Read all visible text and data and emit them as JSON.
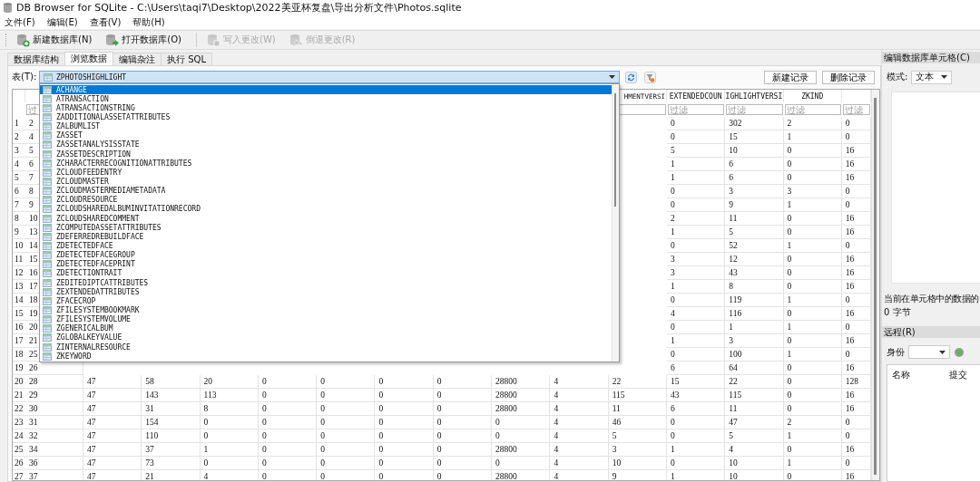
{
  "window": {
    "title": "DB Browser for SQLite - C:\\Users\\taqi7\\Desktop\\2022美亚杯复盘\\导出分析文件\\Photos.sqlite"
  },
  "menu": [
    "文件(F)",
    "编辑(E)",
    "查看(V)",
    "帮助(H)"
  ],
  "toolbar": [
    {
      "kind": "new",
      "label": "新建数据库(N)",
      "disabled": false
    },
    {
      "kind": "open",
      "label": "打开数据库(O)",
      "disabled": false
    },
    {
      "kind": "write",
      "label": "写入更改(W)",
      "disabled": true
    },
    {
      "kind": "revert",
      "label": "倒退更改(R)",
      "disabled": true
    }
  ],
  "tabs": [
    {
      "label": "数据库结构",
      "selected": false
    },
    {
      "label": "浏览数据",
      "selected": true
    },
    {
      "label": "编辑杂注",
      "selected": false
    },
    {
      "label": "执行 SQL",
      "selected": false
    }
  ],
  "table_picker": {
    "label": "表(T):",
    "value": "ZPHOTOSHIGHLIGHT",
    "expanded": true,
    "options": [
      {
        "label": "ACHANGE",
        "selected": true
      },
      {
        "label": "ATRANSACTION",
        "selected": false
      },
      {
        "label": "ATRANSACTIONSTRING",
        "selected": false
      },
      {
        "label": "ZADDITIONALASSETATTRIBUTES",
        "selected": false
      },
      {
        "label": "ZALBUMLIST",
        "selected": false
      },
      {
        "label": "ZASSET",
        "selected": false
      },
      {
        "label": "ZASSETANALYSISSTATE",
        "selected": false
      },
      {
        "label": "ZASSETDESCRIPTION",
        "selected": false
      },
      {
        "label": "ZCHARACTERRECOGNITIONATTRIBUTES",
        "selected": false
      },
      {
        "label": "ZCLOUDFEEDENTRY",
        "selected": false
      },
      {
        "label": "ZCLOUDMASTER",
        "selected": false
      },
      {
        "label": "ZCLOUDMASTERMEDIAMETADATA",
        "selected": false
      },
      {
        "label": "ZCLOUDRESOURCE",
        "selected": false
      },
      {
        "label": "ZCLOUDSHAREDALBUMINVITATIONRECORD",
        "selected": false
      },
      {
        "label": "ZCLOUDSHAREDCOMMENT",
        "selected": false
      },
      {
        "label": "ZCOMPUTEDASSETATTRIBUTES",
        "selected": false
      },
      {
        "label": "ZDEFERREDREBUILDFACE",
        "selected": false
      },
      {
        "label": "ZDETECTEDFACE",
        "selected": false
      },
      {
        "label": "ZDETECTEDFACEGROUP",
        "selected": false
      },
      {
        "label": "ZDETECTEDFACEPRINT",
        "selected": false
      },
      {
        "label": "ZDETECTIONTRAIT",
        "selected": false
      },
      {
        "label": "ZEDITEDIPTCATTRIBUTES",
        "selected": false
      },
      {
        "label": "ZEXTENDEDATTRIBUTES",
        "selected": false
      },
      {
        "label": "ZFACECROP",
        "selected": false
      },
      {
        "label": "ZFILESYSTEMBOOKMARK",
        "selected": false
      },
      {
        "label": "ZFILESYSTEMVOLUME",
        "selected": false
      },
      {
        "label": "ZGENERICALBUM",
        "selected": false
      },
      {
        "label": "ZGLOBALKEYVALUE",
        "selected": false
      },
      {
        "label": "ZINTERNALRESOURCE",
        "selected": false
      },
      {
        "label": "ZKEYWORD",
        "selected": false
      }
    ]
  },
  "record_buttons": [
    "新建记录",
    "删除记录"
  ],
  "grid": {
    "headers": [
      "HMENTVERSI",
      "EXTENDEDCOUN",
      "IGHLIGHTVERSI",
      "ZKIND"
    ],
    "first_filter": {
      "placeholder": "过"
    },
    "filters": [
      {
        "placeholder": "过滤"
      },
      {
        "placeholder": "过滤"
      },
      {
        "placeholder": "过滤"
      },
      {
        "placeholder": "过滤"
      }
    ],
    "rows": [
      {
        "kind": "covered",
        "number": "1",
        "first": "2",
        "tail": [
          "0",
          "302",
          "2",
          "0"
        ]
      },
      {
        "kind": "covered",
        "number": "2",
        "first": "4",
        "tail": [
          "0",
          "15",
          "1",
          "0"
        ]
      },
      {
        "kind": "covered",
        "number": "3",
        "first": "5",
        "tail": [
          "5",
          "10",
          "0",
          "16"
        ]
      },
      {
        "kind": "covered",
        "number": "4",
        "first": "6",
        "tail": [
          "1",
          "6",
          "0",
          "16"
        ]
      },
      {
        "kind": "covered",
        "number": "5",
        "first": "7",
        "tail": [
          "1",
          "6",
          "0",
          "16"
        ]
      },
      {
        "kind": "covered",
        "number": "6",
        "first": "8",
        "tail": [
          "0",
          "3",
          "3",
          "0"
        ]
      },
      {
        "kind": "covered",
        "number": "7",
        "first": "9",
        "tail": [
          "0",
          "9",
          "1",
          "0"
        ]
      },
      {
        "kind": "covered",
        "number": "8",
        "first": "10",
        "tail": [
          "2",
          "11",
          "0",
          "16"
        ]
      },
      {
        "kind": "covered",
        "number": "9",
        "first": "13",
        "tail": [
          "1",
          "5",
          "0",
          "16"
        ]
      },
      {
        "kind": "covered",
        "number": "10",
        "first": "14",
        "tail": [
          "0",
          "52",
          "1",
          "0"
        ]
      },
      {
        "kind": "covered",
        "number": "11",
        "first": "15",
        "tail": [
          "3",
          "12",
          "0",
          "16"
        ]
      },
      {
        "kind": "covered",
        "number": "12",
        "first": "16",
        "tail": [
          "3",
          "43",
          "0",
          "16"
        ]
      },
      {
        "kind": "covered",
        "number": "13",
        "first": "17",
        "tail": [
          "1",
          "8",
          "0",
          "16"
        ]
      },
      {
        "kind": "covered",
        "number": "14",
        "first": "18",
        "tail": [
          "0",
          "119",
          "1",
          "0"
        ]
      },
      {
        "kind": "covered",
        "number": "15",
        "first": "19",
        "tail": [
          "4",
          "116",
          "0",
          "16"
        ]
      },
      {
        "kind": "covered",
        "number": "16",
        "first": "20",
        "tail": [
          "0",
          "1",
          "1",
          "0"
        ]
      },
      {
        "kind": "covered",
        "number": "17",
        "first": "21",
        "tail": [
          "1",
          "3",
          "0",
          "16"
        ]
      },
      {
        "kind": "covered",
        "number": "18",
        "first": "25",
        "tail": [
          "0",
          "100",
          "1",
          "0"
        ]
      },
      {
        "kind": "covered",
        "number": "19",
        "first": "26",
        "tail": [
          "6",
          "64",
          "0",
          "16"
        ]
      },
      {
        "kind": "full",
        "number": "20",
        "cells": [
          "28",
          "47",
          "58",
          "20",
          "0",
          "0",
          "0",
          "0",
          "28800",
          "4",
          "22",
          "15",
          "22",
          "0",
          "128"
        ]
      },
      {
        "kind": "full",
        "number": "21",
        "cells": [
          "29",
          "47",
          "143",
          "113",
          "0",
          "0",
          "0",
          "0",
          "28800",
          "4",
          "115",
          "43",
          "115",
          "0",
          "16"
        ]
      },
      {
        "kind": "full",
        "number": "22",
        "cells": [
          "30",
          "47",
          "31",
          "8",
          "0",
          "0",
          "0",
          "0",
          "28800",
          "4",
          "11",
          "6",
          "11",
          "0",
          "16"
        ]
      },
      {
        "kind": "full",
        "number": "23",
        "cells": [
          "31",
          "47",
          "154",
          "0",
          "0",
          "0",
          "0",
          "0",
          "0",
          "4",
          "46",
          "0",
          "47",
          "2",
          "0"
        ]
      },
      {
        "kind": "full",
        "number": "24",
        "cells": [
          "32",
          "47",
          "110",
          "0",
          "0",
          "0",
          "0",
          "0",
          "0",
          "4",
          "5",
          "0",
          "5",
          "1",
          "0"
        ]
      },
      {
        "kind": "full",
        "number": "25",
        "cells": [
          "34",
          "47",
          "37",
          "1",
          "0",
          "0",
          "0",
          "0",
          "28800",
          "4",
          "3",
          "1",
          "4",
          "0",
          "16"
        ]
      },
      {
        "kind": "full",
        "number": "26",
        "cells": [
          "36",
          "47",
          "73",
          "0",
          "0",
          "0",
          "0",
          "0",
          "0",
          "4",
          "10",
          "0",
          "10",
          "1",
          "0"
        ]
      },
      {
        "kind": "full",
        "number": "27",
        "cells": [
          "37",
          "47",
          "21",
          "4",
          "0",
          "0",
          "0",
          "0",
          "28800",
          "4",
          "9",
          "1",
          "10",
          "0",
          "16"
        ]
      }
    ]
  },
  "edit_cell_pane": {
    "title": "编辑数据库单元格(C)",
    "mode_label": "模式:",
    "mode_value": "文本",
    "info": "当前在单元格中的数据的",
    "size": "0 字节"
  },
  "remote_pane": {
    "title": "远程(R)",
    "identity_label": "身份",
    "columns": [
      "名称",
      "提交"
    ]
  }
}
